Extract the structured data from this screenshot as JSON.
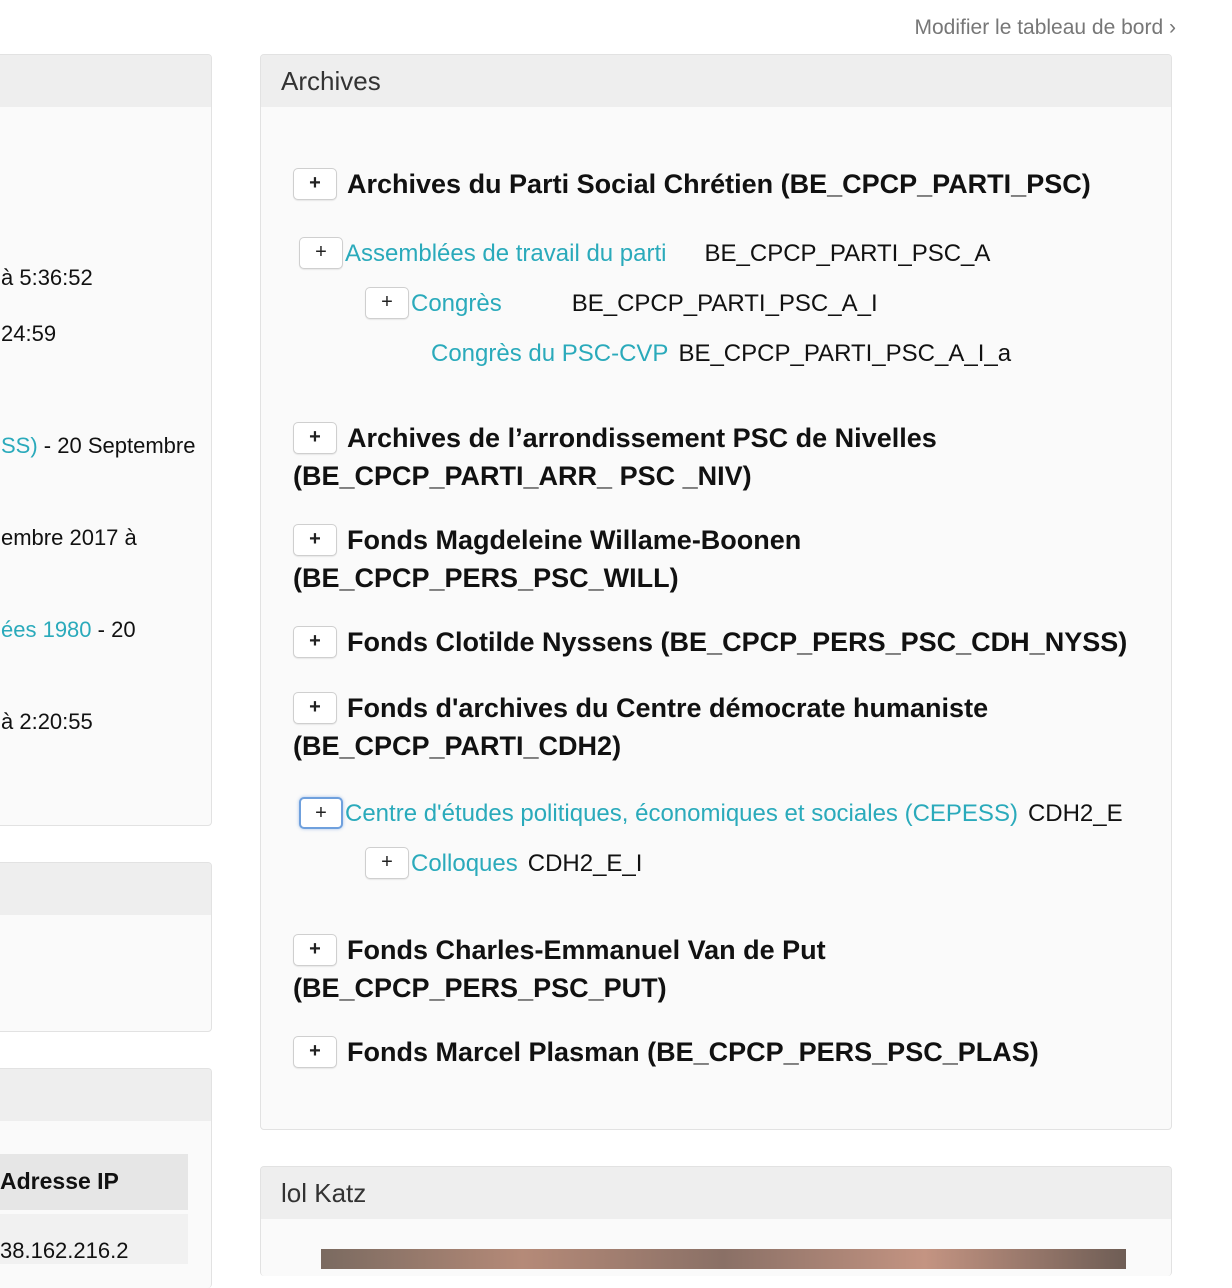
{
  "dashboard": {
    "edit_link": "Modifier le tableau de bord ›"
  },
  "left_column": {
    "lines": [
      {
        "text": "à 5:36:52"
      },
      {
        "text": "24:59"
      },
      {
        "link": "SS)",
        "rest": " - 20 Septembre"
      },
      {
        "text": "embre 2017 à"
      },
      {
        "link": "ées 1980",
        "rest": " - 20"
      },
      {
        "text": "à 2:20:55"
      }
    ],
    "ip_header": "Adresse IP",
    "ip_value": "38.162.216.2"
  },
  "archives": {
    "title": "Archives",
    "expand_symbol": "+",
    "nodes": [
      {
        "label": "Archives du Parti Social Chrétien (BE_CPCP_PARTI_PSC)"
      },
      {
        "label": "Assemblées de travail du parti",
        "code": "BE_CPCP_PARTI_PSC_A"
      },
      {
        "label": "Congrès",
        "code": "BE_CPCP_PARTI_PSC_A_I"
      },
      {
        "label": "Congrès du PSC-CVP",
        "code": "BE_CPCP_PARTI_PSC_A_I_a"
      },
      {
        "label": "Archives de l’arrondissement PSC de Nivelles (BE_CPCP_PARTI_ARR_ PSC _NIV)"
      },
      {
        "label": "Fonds Magdeleine Willame-Boonen (BE_CPCP_PERS_PSC_WILL)"
      },
      {
        "label": "Fonds Clotilde Nyssens (BE_CPCP_PERS_PSC_CDH_NYSS)"
      },
      {
        "label": "Fonds d'archives du Centre démocrate humaniste (BE_CPCP_PARTI_CDH2)"
      },
      {
        "label": "Centre d'études politiques, économiques et sociales (CEPESS)",
        "code": "CDH2_E"
      },
      {
        "label": "Colloques",
        "code": "CDH2_E_I"
      },
      {
        "label": "Fonds Charles-Emmanuel Van de Put (BE_CPCP_PERS_PSC_PUT)"
      },
      {
        "label": "Fonds Marcel Plasman (BE_CPCP_PERS_PSC_PLAS)"
      }
    ]
  },
  "lol_katz": {
    "title": "lol Katz"
  }
}
